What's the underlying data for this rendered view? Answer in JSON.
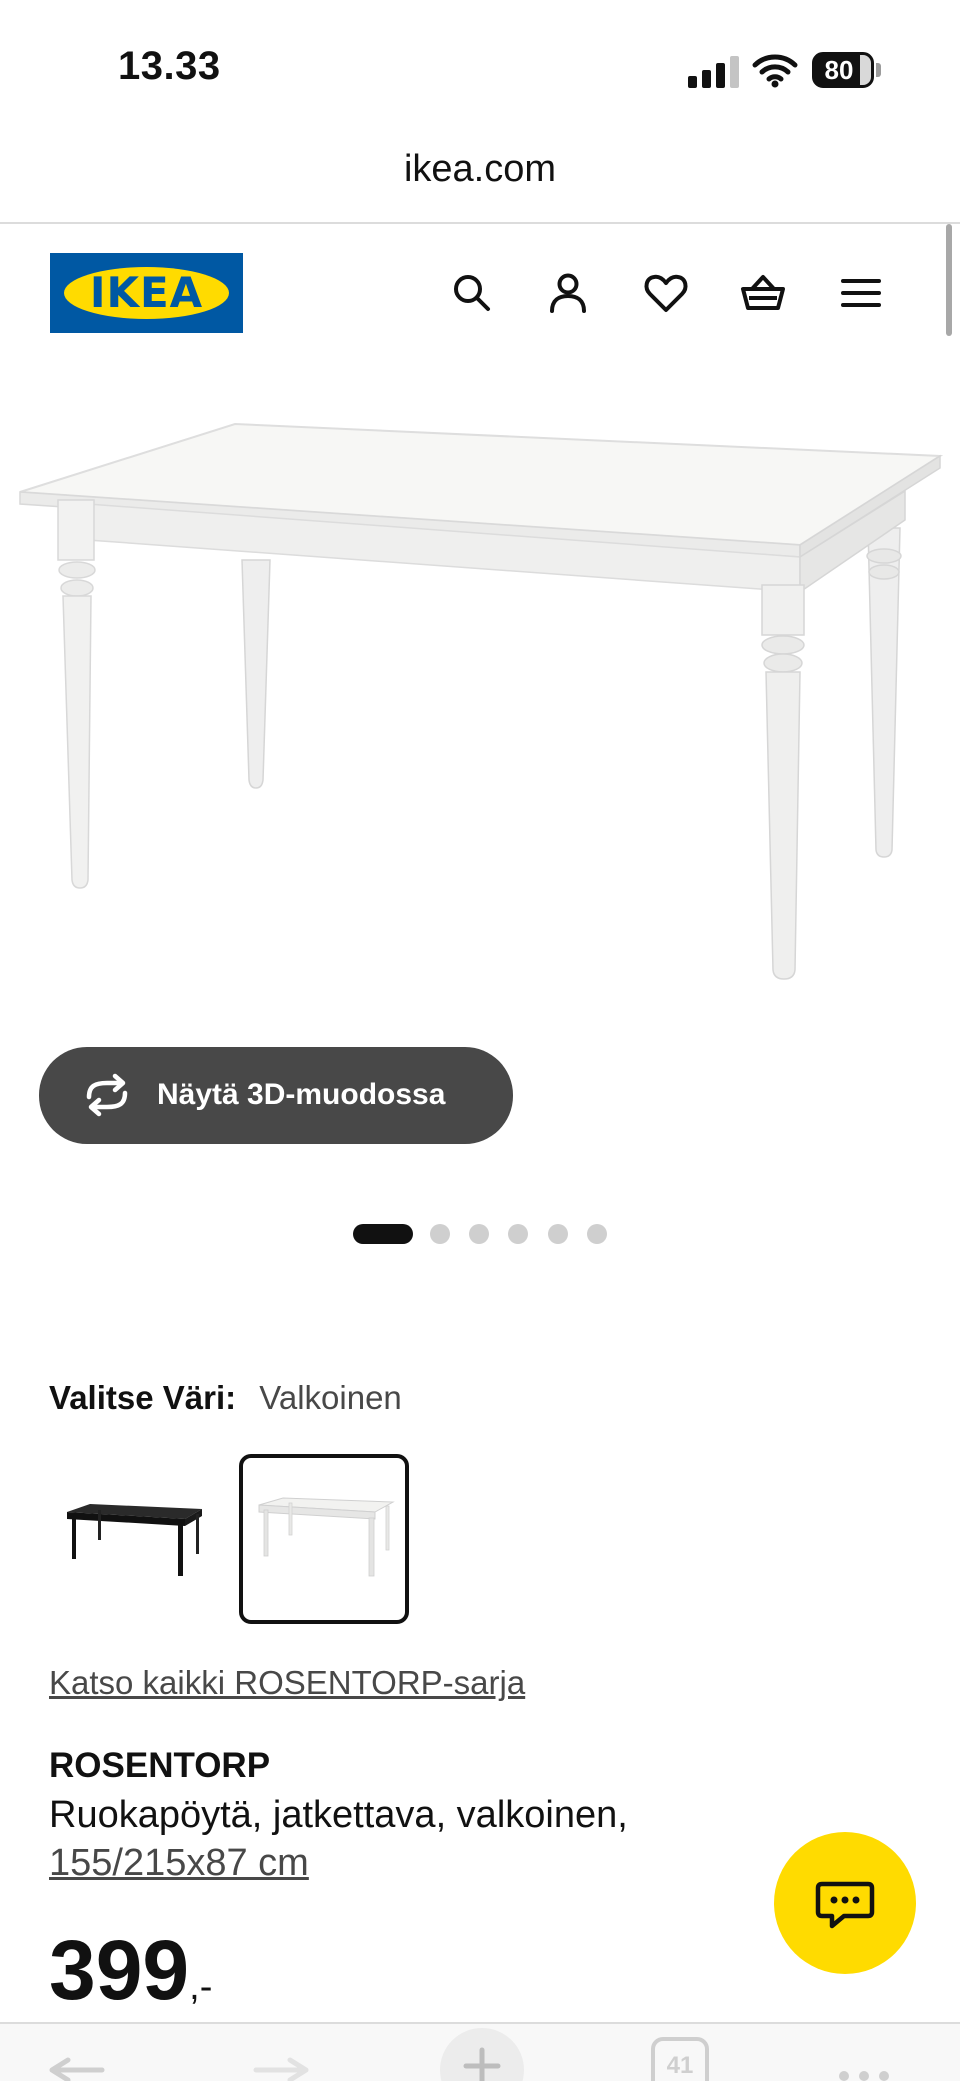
{
  "status_bar": {
    "time": "13.33",
    "battery": "80"
  },
  "browser": {
    "url": "ikea.com",
    "tab_count": "41"
  },
  "header": {
    "logo": "IKEA",
    "icons": [
      "search-icon",
      "user-icon",
      "heart-icon",
      "basket-icon",
      "menu-icon"
    ]
  },
  "gallery": {
    "view_3d_label": "Näytä 3D-muodossa",
    "active_index": 1,
    "total": 6
  },
  "color_select": {
    "label": "Valitse Väri:",
    "value": "Valkoinen",
    "swatches": [
      "black",
      "white"
    ],
    "selected": "white"
  },
  "product": {
    "series_link": "Katso kaikki ROSENTORP-sarja",
    "name": "ROSENTORP",
    "description": "Ruokapöytä, jatkettava, valkoinen,",
    "size": "155/215x87 cm",
    "price": "399",
    "price_suffix": ",-"
  },
  "colors": {
    "ikea_blue": "#0058a3",
    "ikea_yellow": "#ffdb00",
    "dark_button": "#484848"
  }
}
